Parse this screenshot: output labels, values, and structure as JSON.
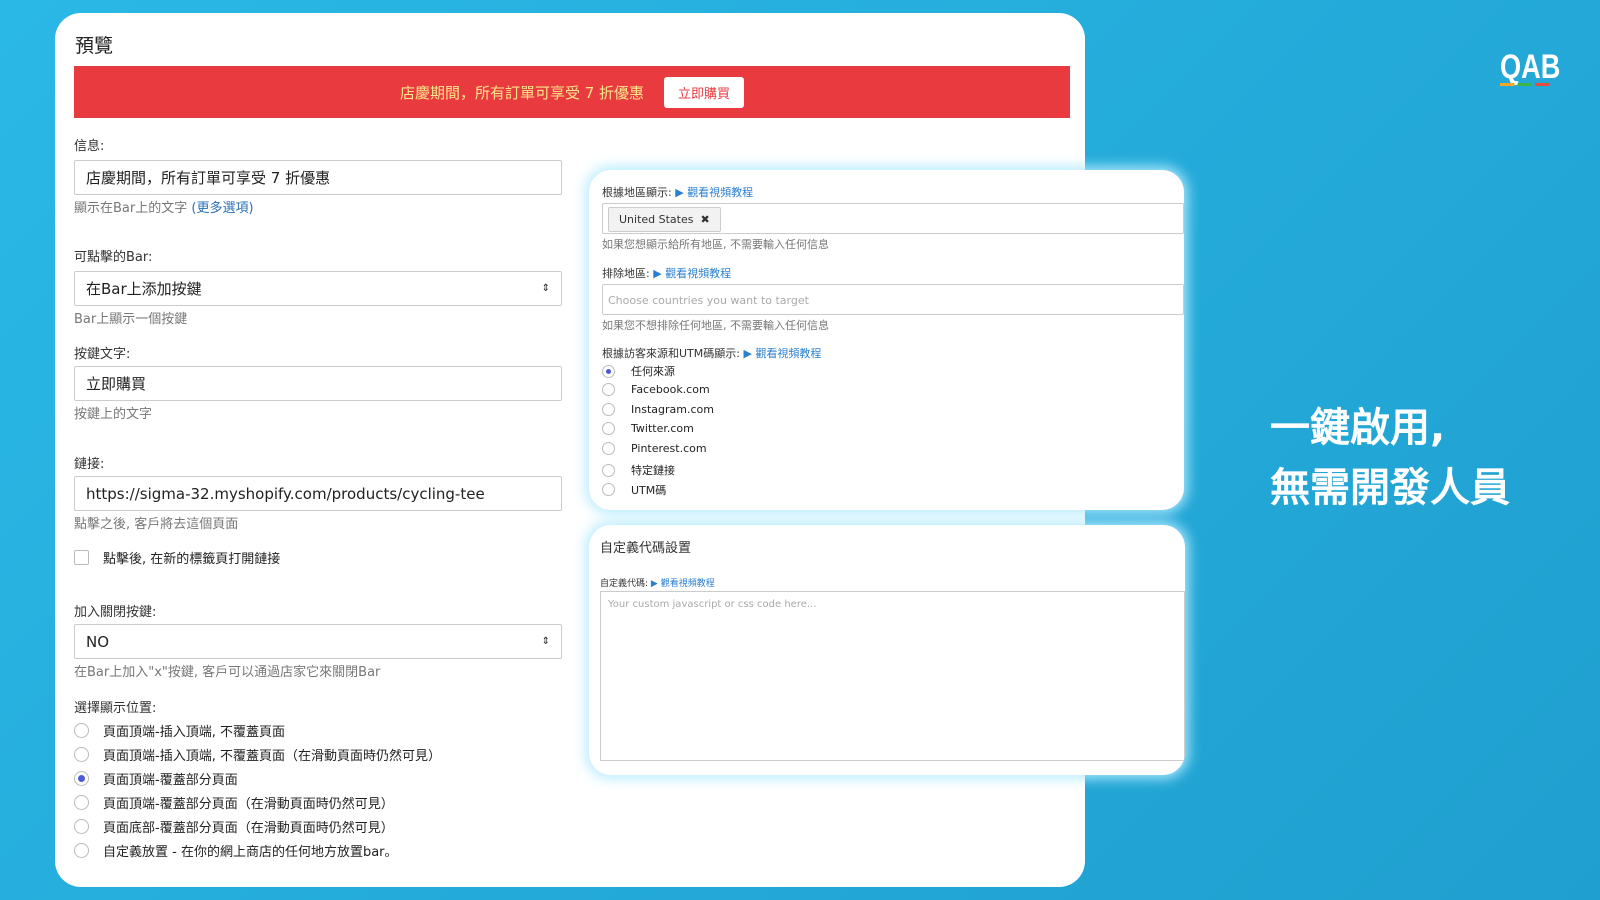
{
  "logo": {
    "text": "QAB",
    "colors": [
      "#f5a623",
      "#3bb54a",
      "#e84c3d"
    ]
  },
  "hero": {
    "line1": "一鍵啟用,",
    "line2": "無需開發人員"
  },
  "preview": {
    "title": "預覽",
    "bar_text": "店慶期間，所有訂單可享受 7 折優惠",
    "bar_button": "立即購買",
    "bar_color": "#e93a40"
  },
  "form": {
    "message_label": "信息:",
    "message_value": "店慶期間，所有訂單可享受 7 折優惠",
    "message_help": "顯示在Bar上的文字",
    "message_more": "(更多選項)",
    "clickable_label": "可點擊的Bar:",
    "clickable_value": "在Bar上添加按鍵",
    "clickable_help": "Bar上顯示一個按鍵",
    "button_text_label": "按鍵文字:",
    "button_text_value": "立即購買",
    "button_text_help": "按鍵上的文字",
    "link_label": "鏈接:",
    "link_value": "https://sigma-32.myshopify.com/products/cycling-tee",
    "link_help": "點擊之後, 客戶將去這個頁面",
    "new_tab_label": "點擊後, 在新的標籤頁打開鏈接",
    "close_label": "加入關閉按鍵:",
    "close_value": "NO",
    "close_help": "在Bar上加入\"x\"按鍵, 客戶可以通過店家它來關閉Bar",
    "position_label": "選擇顯示位置:",
    "positions": [
      {
        "label": "頁面頂端-插入頂端, 不覆蓋頁面",
        "selected": false
      },
      {
        "label": "頁面頂端-插入頂端, 不覆蓋頁面（在滑動頁面時仍然可見）",
        "selected": false
      },
      {
        "label": "頁面頂端-覆蓋部分頁面",
        "selected": true
      },
      {
        "label": "頁面頂端-覆蓋部分頁面（在滑動頁面時仍然可見）",
        "selected": false
      },
      {
        "label": "頁面底部-覆蓋部分頁面（在滑動頁面時仍然可見）",
        "selected": false
      },
      {
        "label": "自定義放置 - 在你的網上商店的任何地方放置bar。",
        "selected": false
      }
    ]
  },
  "targeting": {
    "region_label": "根據地區顯示:",
    "video_link": "觀看視頻教程",
    "region_tag": "United States",
    "region_help": "如果您想顯示給所有地區, 不需要輸入任何信息",
    "exclude_label": "排除地區:",
    "exclude_placeholder": "Choose countries you want to target",
    "exclude_help": "如果您不想排除任何地區, 不需要輸入任何信息",
    "source_label": "根據訪客來源和UTM碼顯示:",
    "sources": [
      {
        "label": "任何來源",
        "selected": true
      },
      {
        "label": "Facebook.com",
        "selected": false
      },
      {
        "label": "Instagram.com",
        "selected": false
      },
      {
        "label": "Twitter.com",
        "selected": false
      },
      {
        "label": "Pinterest.com",
        "selected": false
      },
      {
        "label": "特定鏈接",
        "selected": false
      },
      {
        "label": "UTM碼",
        "selected": false
      }
    ]
  },
  "custom_code": {
    "title": "自定義代碼設置",
    "label": "自定義代碼:",
    "video_link": "觀看視頻教程",
    "placeholder": "Your custom javascript or css code here..."
  }
}
